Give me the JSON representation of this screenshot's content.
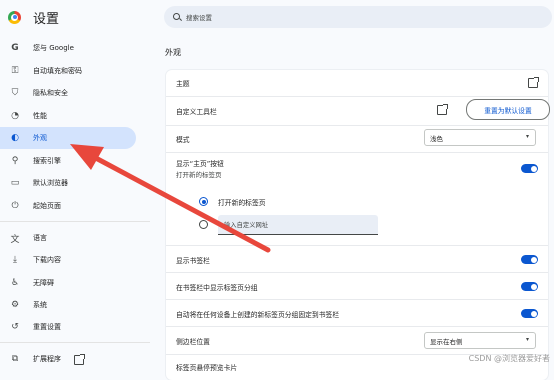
{
  "app": {
    "title": "设置"
  },
  "sidebar": {
    "items": [
      {
        "label": "您与 Google",
        "icon": "google-icon",
        "glyph": "G"
      },
      {
        "label": "自动填充和密码",
        "icon": "key-icon",
        "glyph": "⚿"
      },
      {
        "label": "隐私和安全",
        "icon": "shield-icon",
        "glyph": "⛉"
      },
      {
        "label": "性能",
        "icon": "speedometer-icon",
        "glyph": "◔"
      },
      {
        "label": "外观",
        "icon": "palette-icon",
        "glyph": "◐"
      },
      {
        "label": "搜索引擎",
        "icon": "search-icon",
        "glyph": "⚲"
      },
      {
        "label": "默认浏览器",
        "icon": "browser-icon",
        "glyph": "▭"
      },
      {
        "label": "起始页面",
        "icon": "power-icon",
        "glyph": "⏻"
      },
      {
        "label": "语言",
        "icon": "translate-icon",
        "glyph": "文"
      },
      {
        "label": "下载内容",
        "icon": "download-icon",
        "glyph": "⤓"
      },
      {
        "label": "无障碍",
        "icon": "accessibility-icon",
        "glyph": "♿"
      },
      {
        "label": "系统",
        "icon": "wrench-icon",
        "glyph": "⚙"
      },
      {
        "label": "重置设置",
        "icon": "reset-icon",
        "glyph": "↺"
      },
      {
        "label": "扩展程序",
        "icon": "puzzle-icon",
        "glyph": "⧉"
      }
    ]
  },
  "search": {
    "placeholder": "搜索设置"
  },
  "section": {
    "title": "外观"
  },
  "appearance": {
    "theme_label": "主题",
    "toolbar_label": "自定义工具栏",
    "reset_button": "重置为默认设置",
    "mode_label": "模式",
    "mode_value": "浅色",
    "home_button_label": "显示“主页”按钮",
    "home_button_sub": "打开新的标签页",
    "radio_newtab": "打开新的标签页",
    "custom_url_placeholder": "输入自定义网址",
    "bookmarks_bar_label": "显示书签栏",
    "tab_groups_label": "在书签栏中显示标签页分组",
    "autopin_label": "自动将在任何设备上创建的新标签页分组固定到书签栏",
    "side_panel_label": "侧边栏位置",
    "side_panel_value": "显示在右侧",
    "partial_label": "标签页悬停预览卡片"
  },
  "watermark": "CSDN @浏览器爱好者",
  "colors": {
    "accent": "#0b57d0",
    "active_bg": "#d3e3fd",
    "arrow": "#e8473c"
  }
}
